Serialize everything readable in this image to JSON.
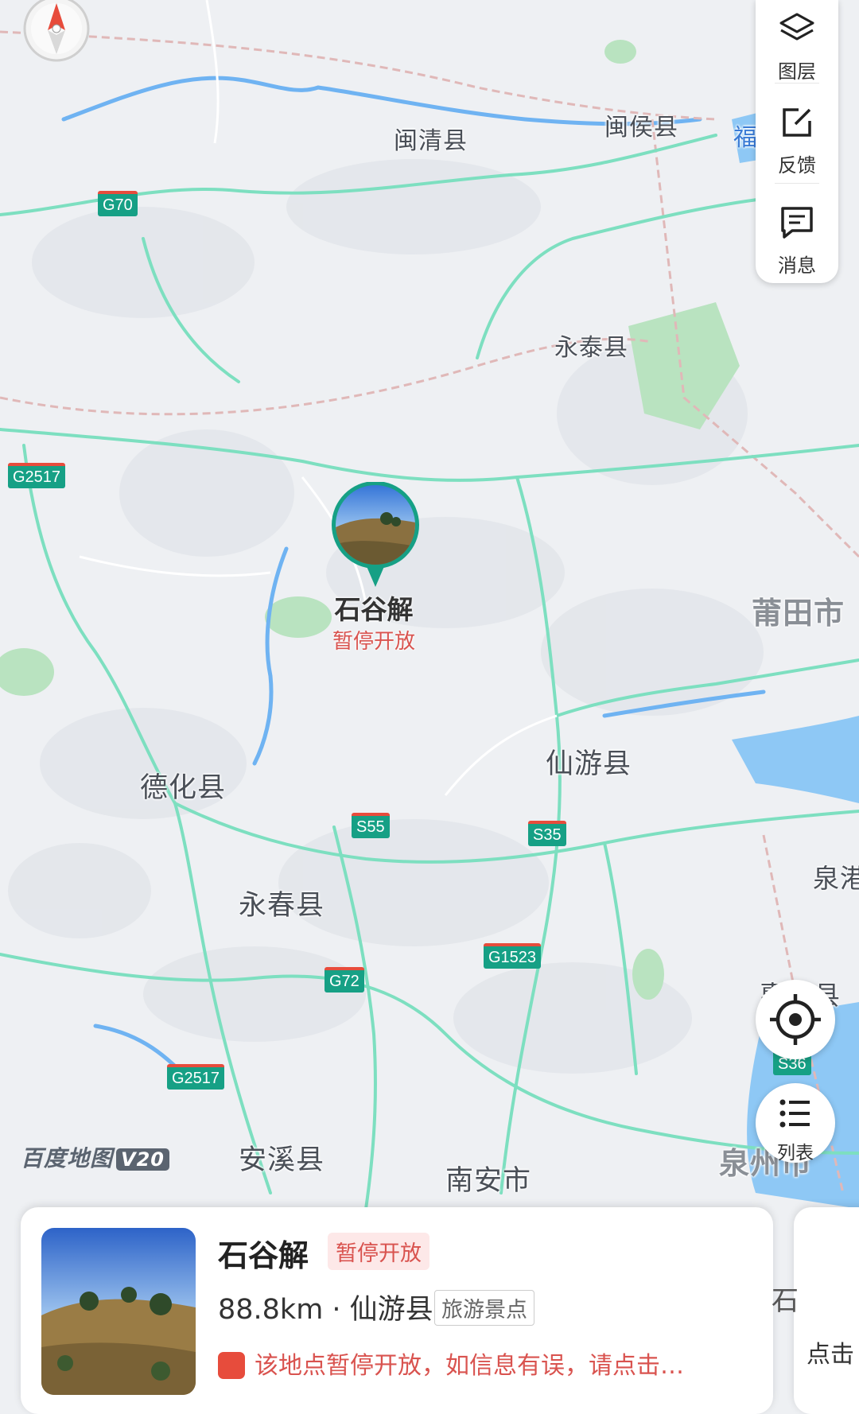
{
  "map": {
    "labels": [
      {
        "id": "minqing",
        "text": "闽清县"
      },
      {
        "id": "minhou",
        "text": "闽侯县"
      },
      {
        "id": "yongtai",
        "text": "永泰县"
      },
      {
        "id": "putian",
        "text": "莆田市"
      },
      {
        "id": "dehua",
        "text": "德化县"
      },
      {
        "id": "xianyou",
        "text": "仙游县"
      },
      {
        "id": "yongchun",
        "text": "永春县"
      },
      {
        "id": "anxi",
        "text": "安溪县"
      },
      {
        "id": "nanan",
        "text": "南安市"
      },
      {
        "id": "quanzhou",
        "text": "泉州市"
      },
      {
        "id": "quangang",
        "text": "泉港"
      },
      {
        "id": "huian",
        "text": "惠安县"
      },
      {
        "id": "fu",
        "text": "福"
      }
    ],
    "shields": [
      {
        "id": "g70",
        "text": "G70"
      },
      {
        "id": "g2517a",
        "text": "G2517"
      },
      {
        "id": "s55",
        "text": "S55"
      },
      {
        "id": "s35",
        "text": "S35"
      },
      {
        "id": "g1523",
        "text": "G1523"
      },
      {
        "id": "g72",
        "text": "G72"
      },
      {
        "id": "g2517b",
        "text": "G2517"
      },
      {
        "id": "s36",
        "text": "S36"
      }
    ],
    "colors": {
      "road": "#7ddfc0",
      "water": "#5aa9f0",
      "park": "#a8ddb0",
      "rail": "#e0b8b8",
      "accent": "#16a085",
      "alert": "#d9534f"
    }
  },
  "toolbar": {
    "layers_label": "图层",
    "feedback_label": "反馈",
    "message_label": "消息",
    "layers_icon": "layers-icon",
    "feedback_icon": "edit-icon",
    "message_icon": "message-icon"
  },
  "locate_icon": "locate-icon",
  "list_button": {
    "label": "列表",
    "icon": "list-icon"
  },
  "poi": {
    "name": "石谷解",
    "status": "暂停开放"
  },
  "logo": {
    "text": "百度地图",
    "version": "V20"
  },
  "card": {
    "title": "石谷解",
    "badge": "暂停开放",
    "distance": "88.8km · 仙游县",
    "category": "旅游景点",
    "warning": "该地点暂停开放，如信息有误，请点击…"
  },
  "side_card": {
    "text": "点击",
    "char": "石"
  }
}
